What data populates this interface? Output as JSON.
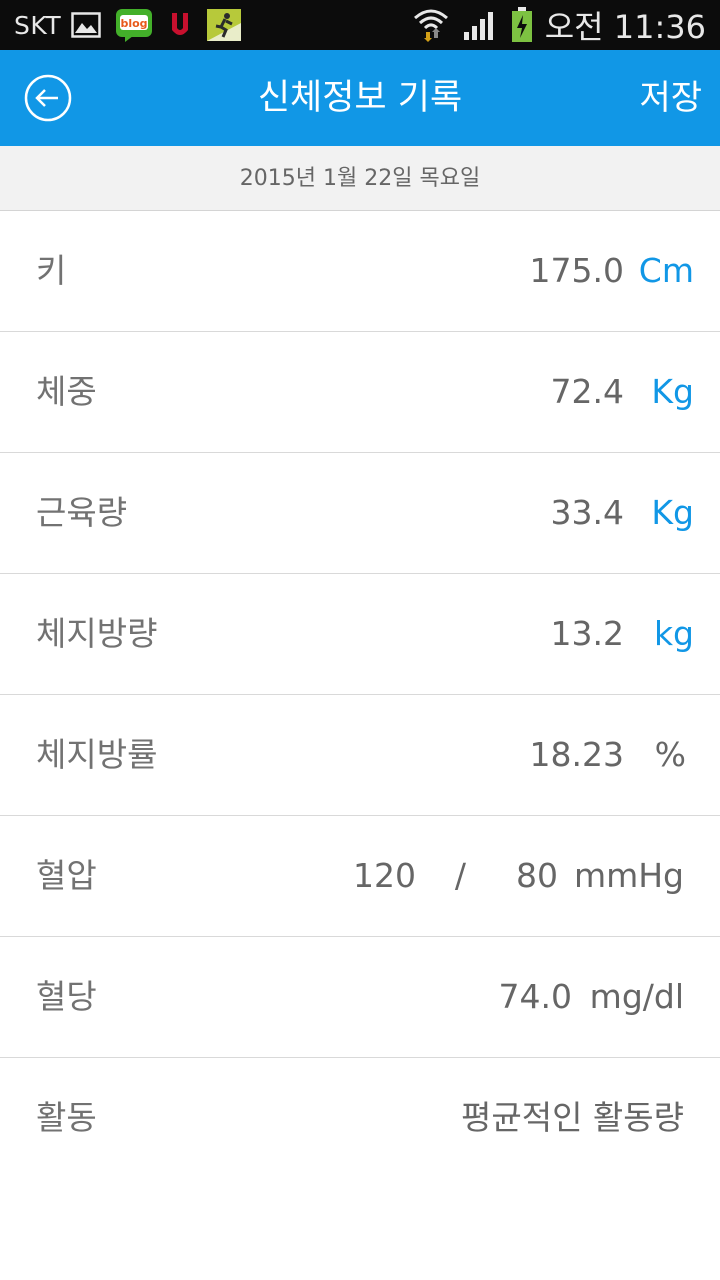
{
  "status_bar": {
    "carrier": "SKT",
    "notification_icons": [
      "gallery-icon",
      "blog-icon",
      "u-app-icon",
      "runner-app-icon"
    ],
    "status_icons": [
      "wifi-icon",
      "signal-icon",
      "battery-charging-icon"
    ],
    "time": "오전 11:36"
  },
  "app_bar": {
    "back_icon": "back-arrow-icon",
    "title": "신체정보 기록",
    "save_label": "저장"
  },
  "date": "2015년 1월 22일 목요일",
  "rows": {
    "height": {
      "label": "키",
      "value": "175.0",
      "unit": "Cm"
    },
    "weight": {
      "label": "체중",
      "value": "72.4",
      "unit": "Kg"
    },
    "muscle": {
      "label": "근육량",
      "value": "33.4",
      "unit": "Kg"
    },
    "fat_mass": {
      "label": "체지방량",
      "value": "13.2",
      "unit": "kg"
    },
    "fat_rate": {
      "label": "체지방률",
      "value": "18.23",
      "unit": "%"
    },
    "blood_pressure": {
      "label": "혈압",
      "systolic": "120",
      "separator": "/",
      "diastolic": "80",
      "unit": "mmHg"
    },
    "blood_sugar": {
      "label": "혈당",
      "value": "74.0",
      "unit": "mg/dl"
    },
    "activity": {
      "label": "활동",
      "value": "평균적인 활동량"
    }
  },
  "colors": {
    "accent": "#1197e6",
    "status_bar": "#0c0c0c",
    "date_bar": "#f2f2f2",
    "text": "#666666"
  }
}
